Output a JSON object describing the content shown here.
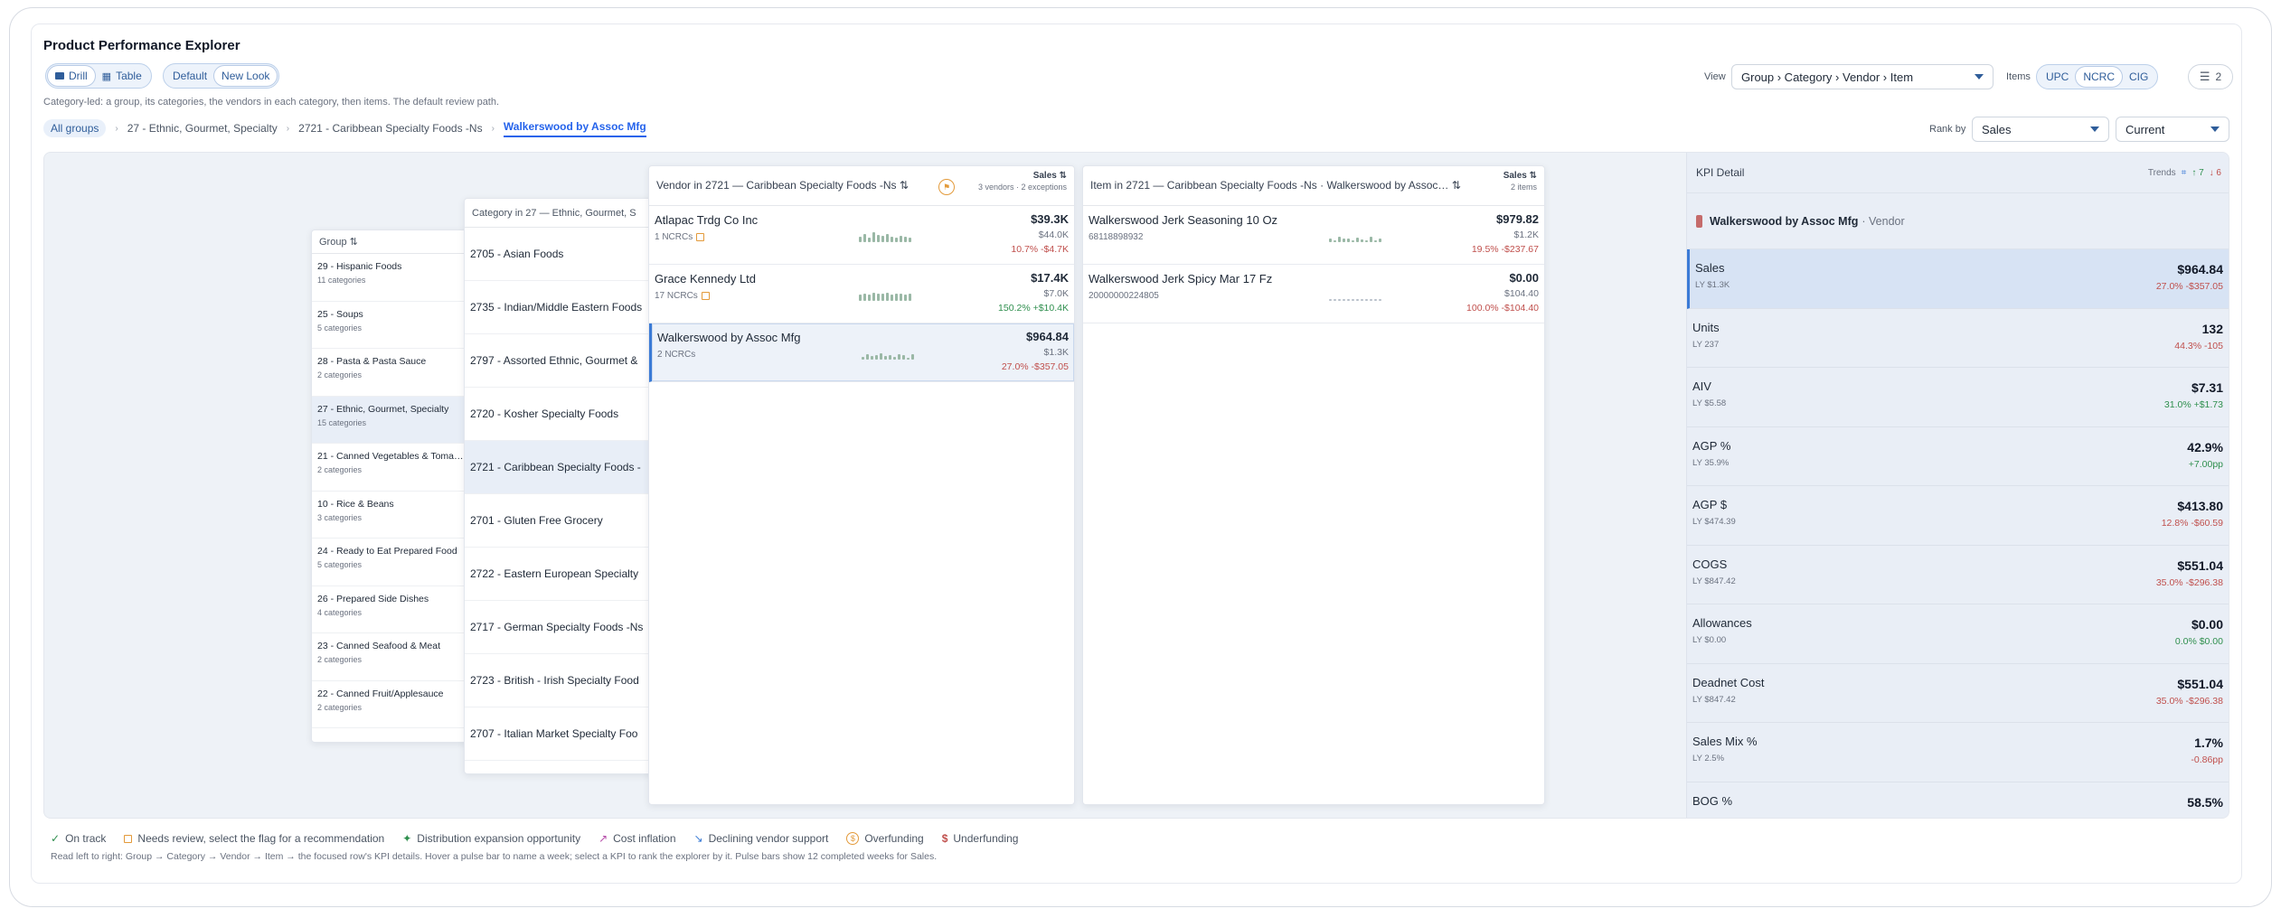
{
  "app": {
    "title": "Product Performance Explorer"
  },
  "mode_toggle": {
    "drill": "Drill",
    "table": "Table"
  },
  "look_toggle": {
    "default": "Default",
    "new_look": "New Look"
  },
  "description": "Category-led: a group, its categories, the vendors in each category, then items. The default review path.",
  "breadcrumbs": {
    "all": "All groups",
    "group": "27 - Ethnic, Gourmet, Specialty",
    "category": "2721 - Caribbean Specialty Foods -Ns",
    "current": "Walkerswood by Assoc Mfg"
  },
  "controls": {
    "view_label": "View",
    "view_value": "Group › Category › Vendor › Item",
    "items_label": "Items",
    "items_options": [
      "UPC",
      "NCRC",
      "CIG"
    ],
    "filter_count": "2",
    "rank_label": "Rank by",
    "rank_value": "Sales",
    "period_value": "Current"
  },
  "group_panel": {
    "header": "Group ⇅",
    "rows": [
      {
        "name": "29 - Hispanic Foods",
        "sub": "11 categories"
      },
      {
        "name": "25 - Soups",
        "sub": "5 categories"
      },
      {
        "name": "28 - Pasta & Pasta Sauce",
        "sub": "2 categories"
      },
      {
        "name": "27 - Ethnic, Gourmet, Specialty",
        "sub": "15 categories"
      },
      {
        "name": "21 - Canned Vegetables & Toma…",
        "sub": "2 categories"
      },
      {
        "name": "10 - Rice & Beans",
        "sub": "3 categories"
      },
      {
        "name": "24 - Ready to Eat Prepared Food",
        "sub": "5 categories"
      },
      {
        "name": "26 - Prepared Side Dishes",
        "sub": "4 categories"
      },
      {
        "name": "23 - Canned Seafood & Meat",
        "sub": "2 categories"
      },
      {
        "name": "22 - Canned Fruit/Applesauce",
        "sub": "2 categories"
      }
    ]
  },
  "category_panel": {
    "header": "Category in 27 — Ethnic, Gourmet, S",
    "rows": [
      "2705 - Asian Foods",
      "2735 - Indian/Middle Eastern Foods",
      "2797 - Assorted Ethnic, Gourmet &",
      "2720 - Kosher Specialty Foods",
      "2721 - Caribbean Specialty Foods -",
      "2701 - Gluten Free Grocery",
      "2722 - Eastern European Specialty",
      "2717 - German Specialty Foods -Ns",
      "2723 - British - Irish Specialty Food",
      "2707 - Italian Market Specialty Foo"
    ]
  },
  "vendor_panel": {
    "header": "Vendor in 2721 — Caribbean Specialty Foods -Ns ⇅",
    "sort": "Sales ⇅",
    "meta": "3 vendors · 2 exceptions",
    "rows": [
      {
        "name": "Atlapac Trdg Co Inc",
        "sub": "1 NCRCs",
        "value": "$39.3K",
        "ly": "$44.0K",
        "delta": "10.7% -$4.7K"
      },
      {
        "name": "Grace Kennedy Ltd",
        "sub": "17 NCRCs",
        "value": "$17.4K",
        "ly": "$7.0K",
        "delta": "150.2% +$10.4K"
      },
      {
        "name": "Walkerswood by Assoc Mfg",
        "sub": "2 NCRCs",
        "value": "$964.84",
        "ly": "$1.3K",
        "delta": "27.0% -$357.05"
      }
    ]
  },
  "item_panel": {
    "header": "Item in 2721 — Caribbean Specialty Foods -Ns · Walkerswood by Assoc… ⇅",
    "sort": "Sales ⇅",
    "meta": "2 items",
    "rows": [
      {
        "name": "Walkerswood Jerk Seasoning 10 Oz",
        "sub": "68118898932",
        "value": "$979.82",
        "ly": "$1.2K",
        "delta": "19.5% -$237.67"
      },
      {
        "name": "Walkerswood Jerk Spicy Mar 17 Fz",
        "sub": "20000000224805",
        "value": "$0.00",
        "ly": "$104.40",
        "delta": "100.0% -$104.40"
      }
    ]
  },
  "kpi": {
    "title": "KPI Detail",
    "trends_label": "Trends",
    "up_count": "↑ 7",
    "down_count": "↓ 6",
    "entity_name": "Walkerswood by Assoc Mfg",
    "entity_type": "· Vendor",
    "rows": [
      {
        "name": "Sales",
        "ly": "LY $1.3K",
        "value": "$964.84",
        "delta": "27.0% -$357.05"
      },
      {
        "name": "Units",
        "ly": "LY 237",
        "value": "132",
        "delta": "44.3% -105"
      },
      {
        "name": "AIV",
        "ly": "LY $5.58",
        "value": "$7.31",
        "delta": "31.0% +$1.73"
      },
      {
        "name": "AGP %",
        "ly": "LY 35.9%",
        "value": "42.9%",
        "delta": "+7.00pp"
      },
      {
        "name": "AGP $",
        "ly": "LY $474.39",
        "value": "$413.80",
        "delta": "12.8% -$60.59"
      },
      {
        "name": "COGS",
        "ly": "LY $847.42",
        "value": "$551.04",
        "delta": "35.0% -$296.38"
      },
      {
        "name": "Allowances",
        "ly": "LY $0.00",
        "value": "$0.00",
        "delta": "0.0% $0.00"
      },
      {
        "name": "Deadnet Cost",
        "ly": "LY $847.42",
        "value": "$551.04",
        "delta": "35.0% -$296.38"
      },
      {
        "name": "Sales Mix %",
        "ly": "LY 2.5%",
        "value": "1.7%",
        "delta": "-0.86pp"
      },
      {
        "name": "BOG %",
        "ly": "",
        "value": "58.5%",
        "delta": ""
      }
    ]
  },
  "legend": {
    "on_track": "On track",
    "needs_review": "Needs review, select the flag for a recommendation",
    "distribution": "Distribution expansion opportunity",
    "cost_inflation": "Cost inflation",
    "declining": "Declining vendor support",
    "overfunding": "Overfunding",
    "underfunding": "Underfunding"
  },
  "hint": "Read left to right: Group → Category → Vendor → Item → the focused row's KPI details. Hover a pulse bar to name a week; select a KPI to rank the explorer by it. Pulse bars show 12 completed weeks for Sales.",
  "colors": {
    "accent": "#2563eb",
    "negative": "#c0504d",
    "positive": "#2f8f4e",
    "flag": "#e39a3a"
  }
}
